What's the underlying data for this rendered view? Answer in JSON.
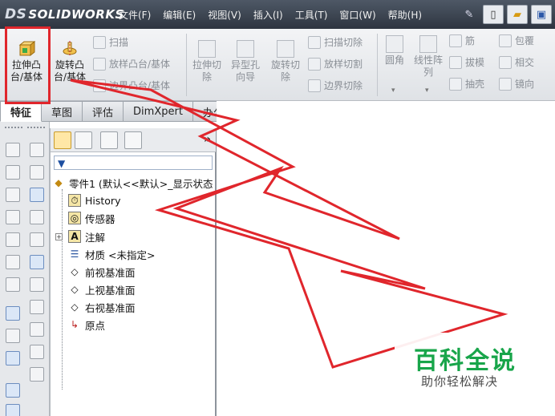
{
  "app": {
    "logo_prefix": "DS",
    "logo_text": "SOLIDWORKS"
  },
  "menu": [
    "文件(F)",
    "编辑(E)",
    "视图(V)",
    "插入(I)",
    "工具(T)",
    "窗口(W)",
    "帮助(H)"
  ],
  "ribbon": {
    "extrude_boss": "拉伸凸\n台/基体",
    "revolve_boss": "旋转凸\n台/基体",
    "sweep": "扫描",
    "loft_boss": "放样凸台/基体",
    "boundary_boss": "边界凸台/基体",
    "extrude_cut": "拉伸切\n除",
    "hole_wizard": "异型孔\n向导",
    "revolve_cut": "旋转切\n除",
    "sweep_cut": "扫描切除",
    "loft_cut": "放样切割",
    "boundary_cut": "边界切除",
    "fillet": "圆角",
    "linear_pattern": "线性阵\n列",
    "rib": "筋",
    "draft": "拔模",
    "shell": "抽壳",
    "wrap": "包覆",
    "intersect": "相交",
    "mirror": "镜向"
  },
  "tabs": [
    "特征",
    "草图",
    "评估",
    "DimXpert",
    "办公室产品"
  ],
  "tree": {
    "root": "零件1 (默认<<默认>_显示状态",
    "items": [
      "History",
      "传感器",
      "注解",
      "材质 <未指定>",
      "前视基准面",
      "上视基准面",
      "右视基准面",
      "原点"
    ]
  },
  "fm_more": "»",
  "watermark": {
    "title": "百科全说",
    "subtitle": "助你轻松解决"
  },
  "colors": {
    "annotation": "#e0262c",
    "watermark_green": "#18a54a"
  }
}
